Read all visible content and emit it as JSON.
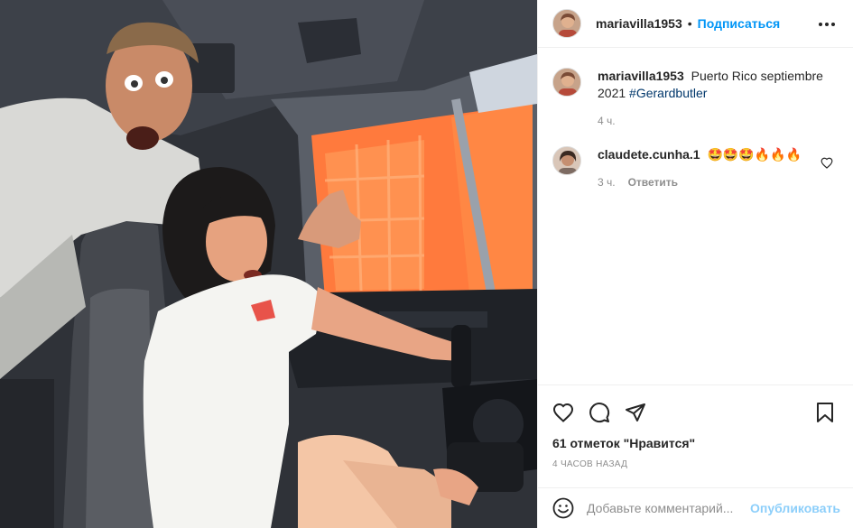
{
  "post": {
    "author": "mariavilla1953",
    "separator": "•",
    "follow_label": "Подписаться",
    "more_icon": "more-horizontal-icon"
  },
  "caption": {
    "username": "mariavilla1953",
    "text": "Puerto Rico septiembre 2021",
    "hashtag": "#Gerardbutler",
    "time": "4 ч."
  },
  "comments": [
    {
      "username": "claudete.cunha.1",
      "text": "🤩🤩🤩🔥🔥🔥",
      "time": "3 ч.",
      "reply_label": "Ответить"
    }
  ],
  "actions": {
    "like_icon": "heart-icon",
    "comment_icon": "comment-icon",
    "share_icon": "share-icon",
    "save_icon": "bookmark-icon"
  },
  "likes": "61 отметок \"Нравится\"",
  "posted_ago": "4 часов назад",
  "add_comment": {
    "placeholder": "Добавьте комментарий...",
    "publish_label": "Опубликовать",
    "emoji_icon": "smiley-icon"
  },
  "colors": {
    "accent": "#0095f6",
    "hashtag": "#00376b",
    "muted": "#8e8e8e",
    "border": "#efefef"
  }
}
